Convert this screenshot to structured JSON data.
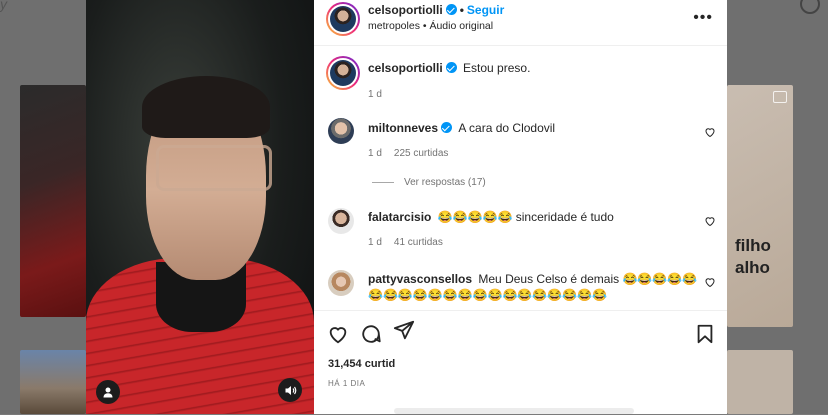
{
  "background": {
    "top_left_text": "y",
    "right_card_text": "filho\nalho"
  },
  "post": {
    "author": "celsoportiolli",
    "follow_label": "Seguir",
    "audio_sub": "metropoles • Áudio original",
    "caption": "Estou preso.",
    "caption_age": "1 d",
    "likes": "31,454 curtid",
    "posted": "HÁ 1 DIA"
  },
  "comments": [
    {
      "user": "miltonneves",
      "text": "A cara do Clodovil",
      "age": "1 d",
      "likes": "225 curtidas",
      "replies": "Ver respostas (17)"
    },
    {
      "user": "falatarcisio",
      "text": "😂😂😂😂😂 sinceridade é tudo",
      "age": "1 d",
      "likes": "41 curtidas"
    },
    {
      "user": "pattyvasconsellos",
      "text": "Meu Deus Celso é demais 😂😂😂😂😂",
      "text2": "😂😂😂😂😂😂😂😂😂😂😂😂😂😂😂😂"
    }
  ],
  "icons": {
    "more": "more-icon",
    "heart": "heart-icon",
    "comment": "comment-icon",
    "share": "share-icon",
    "save": "save-icon",
    "user": "user-tag-icon",
    "sound": "sound-icon"
  },
  "colors": {
    "link": "#0095f6",
    "text": "#262626",
    "muted": "#737373"
  }
}
